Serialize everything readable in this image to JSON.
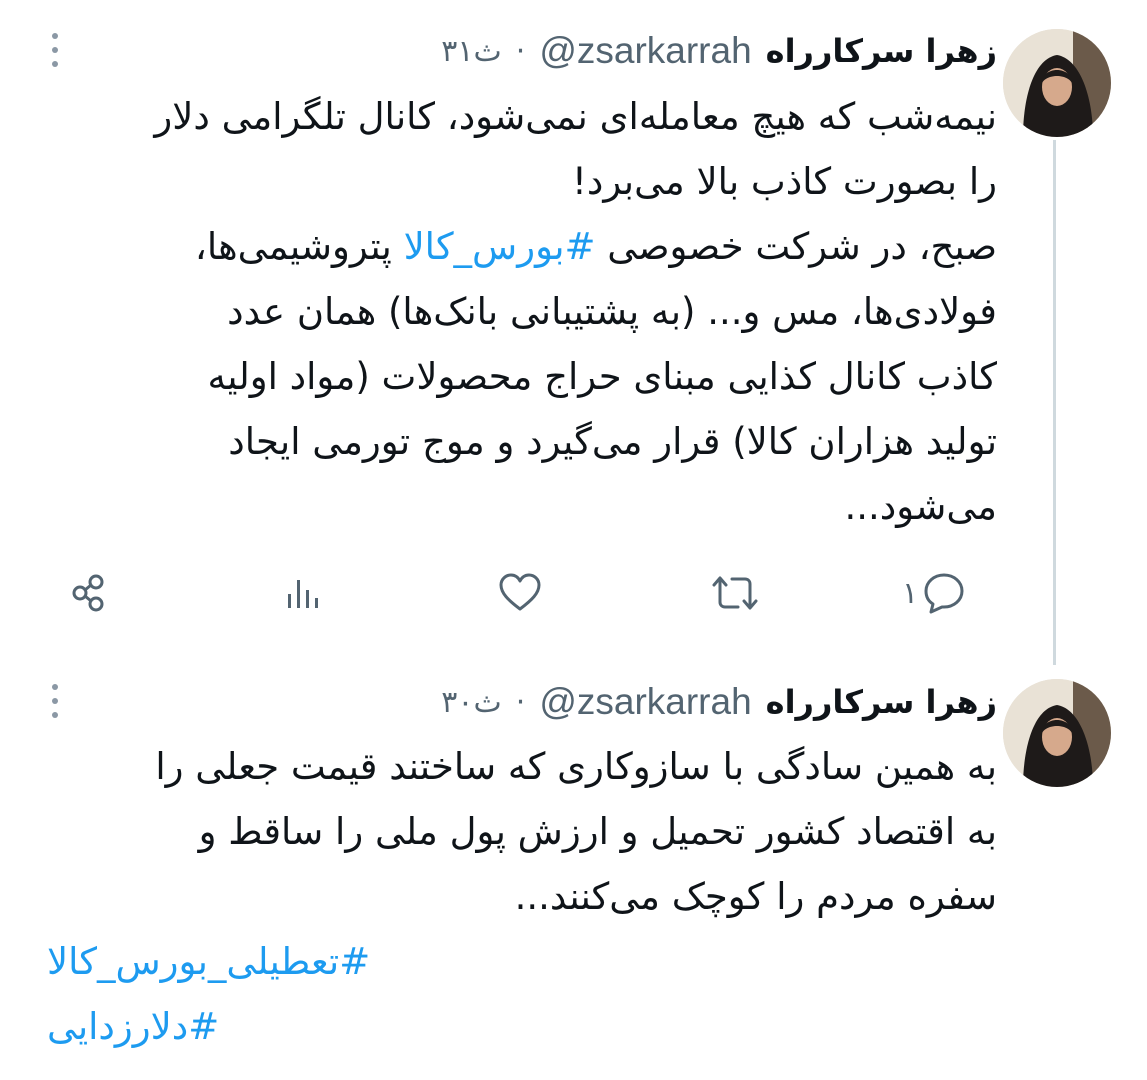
{
  "tweets": [
    {
      "author_name": "زهرا سرکارراه",
      "handle": "@zsarkarrah",
      "separator": "·",
      "time": "۳۱ث",
      "lines": [
        "نیمه‌شب که هیچ معامله‌ای نمی‌شود، کانال تلگرامی دلار",
        "را بصورت کاذب بالا می‌برد!"
      ],
      "line3_prefix": "صبح، در شرکت خصوصی ",
      "line3_hashtag": "#بورس_کالا",
      "line3_suffix": " پتروشیمی‌ها،",
      "lines_after": [
        "فولادی‌ها، مس و... (به پشتیبانی بانک‌ها) همان عدد",
        "کاذب کانال کذایی مبنای حراج محصولات (مواد اولیه",
        "تولید هزاران کالا) قرار می‌گیرد و موج تورمی ایجاد",
        "می‌شود..."
      ],
      "reply_count": "۱"
    },
    {
      "author_name": "زهرا سرکارراه",
      "handle": "@zsarkarrah",
      "separator": "·",
      "time": "۳۰ث",
      "lines": [
        "به همین سادگی با سازوکاری که ساختند قیمت جعلی را",
        "به اقتصاد کشور تحمیل و ارزش پول ملی را ساقط و",
        "سفره مردم را کوچک می‌کنند..."
      ],
      "hashtags": [
        "#تعطیلی_بورس_کالا",
        "#دلارزدایی"
      ]
    }
  ],
  "icons": {
    "share": "share-icon",
    "views": "views-icon",
    "like": "heart-icon",
    "retweet": "retweet-icon",
    "reply": "reply-icon",
    "more": "more-icon"
  },
  "colors": {
    "text": "#0f1419",
    "secondary": "#536471",
    "hashtag": "#1d9bf0",
    "thread_line": "#cfd9de"
  }
}
